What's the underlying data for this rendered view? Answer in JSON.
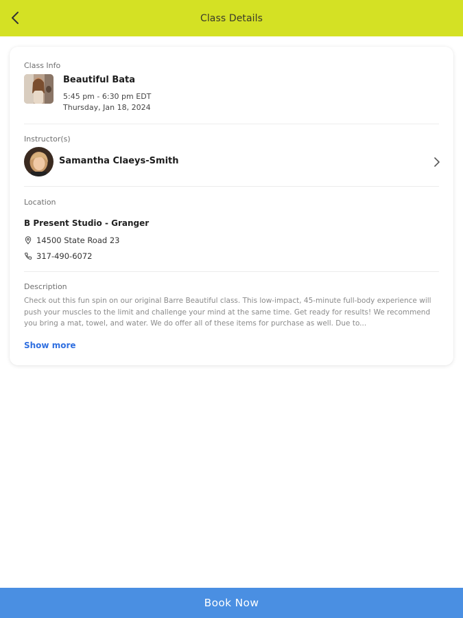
{
  "header": {
    "title": "Class Details",
    "back_icon": "chevron-left-icon"
  },
  "class_info": {
    "label": "Class Info",
    "name": "Beautiful Bata",
    "time": "5:45 pm - 6:30 pm EDT",
    "date": "Thursday, Jan 18, 2024"
  },
  "instructors": {
    "label": "Instructor(s)",
    "name": "Samantha Claeys-Smith",
    "chevron_icon": "chevron-right-icon"
  },
  "location": {
    "label": "Location",
    "studio": "B Present Studio - Granger",
    "address": "14500 State Road 23",
    "phone": "317-490-6072",
    "address_icon": "map-pin-icon",
    "phone_icon": "phone-icon"
  },
  "description": {
    "label": "Description",
    "text": "Check out this fun spin on our original Barre Beautiful class. This low-impact, 45-minute full-body experience will push your muscles to the limit and challenge your mind at the same time. Get ready for results!   We recommend you bring a mat, towel, and water. We do offer all of these items for purchase as well. Due to...",
    "show_more": "Show more"
  },
  "footer": {
    "book_label": "Book Now"
  },
  "colors": {
    "header_bg": "#d4e124",
    "link": "#2f6fe0",
    "book_button": "#4a8fe2"
  }
}
